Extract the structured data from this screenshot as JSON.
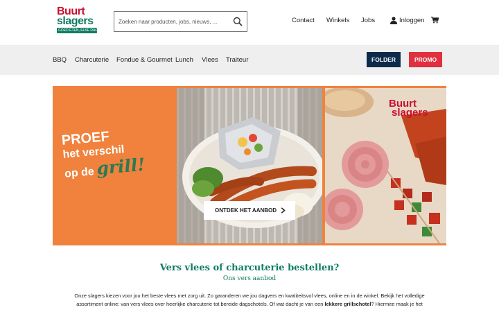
{
  "header": {
    "logo": {
      "line1": "Buurt",
      "line2": "slagers",
      "tagline": "GOED ETEN, ELKE DAG"
    },
    "search": {
      "placeholder": "Zoeken naar producten, jobs, nieuws, ...",
      "value": ""
    },
    "nav": {
      "contact": "Contact",
      "stores": "Winkels",
      "jobs": "Jobs",
      "login": "Inloggen"
    }
  },
  "categories": {
    "items": [
      "BBQ",
      "Charcuterie",
      "Fondue & Gourmet",
      "Lunch",
      "Vlees",
      "Traiteur"
    ],
    "folder_label": "FOLDER",
    "promo_label": "PROMO"
  },
  "hero": {
    "line1": "PROEF",
    "line2": "het verschil",
    "line3": "op de",
    "highlight": "grill!",
    "photo_logo_line1": "Buurt",
    "photo_logo_line2": "slagers",
    "cta_label": "ONTDEK HET AANBOD"
  },
  "intro": {
    "title": "Vers vlees of charcuterie bestellen?",
    "subtitle": "Ons vers aanbod",
    "body_part1": "Onze slagers kiezen voor jou het beste vlees met zorg uit.  Zo garanderen we jou dagvers en kwaliteitsvol vlees, online en in de winkel. Bekijk het volledige assortiment online: van vers vlees over heerlijke charcuterie tot bereide dagschotels.  Of wat dacht je van een ",
    "body_bold": "lekkere grillschotel",
    "body_part2": "? Hiermee maak je het"
  },
  "colors": {
    "brand_green": "#0f7c62",
    "brand_red": "#c8102e",
    "folder_bg": "#0c2a4a",
    "promo_bg": "#e0303f",
    "hero_orange": "#f0823d"
  }
}
